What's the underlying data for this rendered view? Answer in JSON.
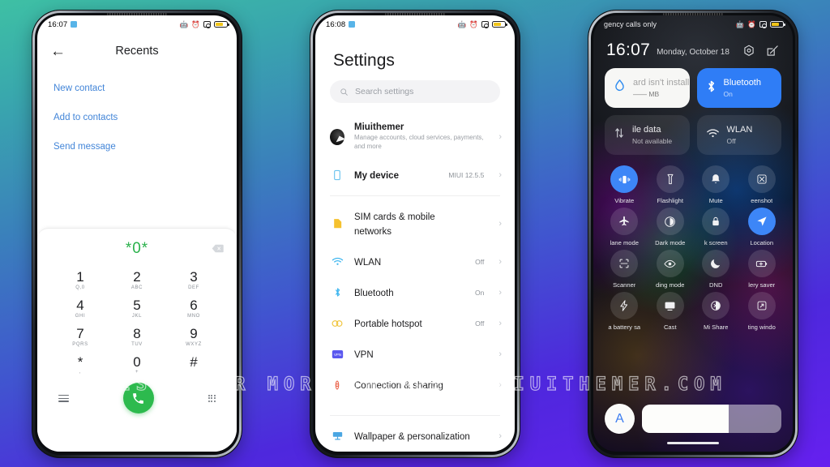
{
  "watermark": "VISIT FOR MORE THEMES - MIUITHEMER.COM",
  "phone1": {
    "status": {
      "time": "16:07",
      "icons": [
        "bluetooth-icon",
        "alarm-icon",
        "dnd-icon",
        "battery-icon"
      ]
    },
    "appbar": {
      "back": "←",
      "title": "Recents"
    },
    "links": [
      {
        "label": "New contact"
      },
      {
        "label": "Add to contacts"
      },
      {
        "label": "Send message"
      }
    ],
    "dialer": {
      "number": "*0*",
      "keys": [
        {
          "digit": "1",
          "sub": "Q,0"
        },
        {
          "digit": "2",
          "sub": "ABC"
        },
        {
          "digit": "3",
          "sub": "DEF"
        },
        {
          "digit": "4",
          "sub": "GHI"
        },
        {
          "digit": "5",
          "sub": "JKL"
        },
        {
          "digit": "6",
          "sub": "MNO"
        },
        {
          "digit": "7",
          "sub": "PQRS"
        },
        {
          "digit": "8",
          "sub": "TUV"
        },
        {
          "digit": "9",
          "sub": "WXYZ"
        },
        {
          "digit": "*",
          "sub": ","
        },
        {
          "digit": "0",
          "sub": "+"
        },
        {
          "digit": "#",
          "sub": ""
        }
      ],
      "call_icon": "✆"
    }
  },
  "phone2": {
    "status": {
      "time": "16:08"
    },
    "title": "Settings",
    "search": {
      "placeholder": "Search settings",
      "value": ""
    },
    "account": {
      "name": "Miuithemer",
      "subtitle": "Manage accounts, cloud services, payments, and more"
    },
    "rows": [
      {
        "label": "My device",
        "value": "MIUI 12.5.5",
        "icon": "device-icon"
      },
      {
        "label": "SIM cards & mobile networks",
        "value": "",
        "icon": "sim-icon"
      },
      {
        "label": "WLAN",
        "value": "Off",
        "icon": "wifi-icon"
      },
      {
        "label": "Bluetooth",
        "value": "On",
        "icon": "bluetooth-icon"
      },
      {
        "label": "Portable hotspot",
        "value": "Off",
        "icon": "hotspot-icon"
      },
      {
        "label": "VPN",
        "value": "",
        "icon": "vpn-icon"
      },
      {
        "label": "Connection & sharing",
        "value": "",
        "icon": "connection-icon"
      },
      {
        "label": "Wallpaper & personalization",
        "value": "",
        "icon": "wallpaper-icon"
      }
    ],
    "chevron": "›"
  },
  "phone3": {
    "status": {
      "carrier": "gency calls only"
    },
    "clock": {
      "time": "16:07",
      "date": "Monday, October 18"
    },
    "header_icons": [
      "settings-gear-icon",
      "edit-icon"
    ],
    "cards": [
      {
        "name": "ard isn't install",
        "state": "—— MB",
        "style": "light",
        "icon": "data-usage-icon"
      },
      {
        "name": "Bluetooth",
        "state": "On",
        "style": "blue",
        "icon": "bluetooth-icon"
      },
      {
        "name": "ile data",
        "state": "Not available",
        "style": "dim",
        "icon": "mobile-data-icon"
      },
      {
        "name": "WLAN",
        "state": "Off",
        "style": "dim",
        "icon": "wifi-icon"
      }
    ],
    "tiles": [
      {
        "label": "Vibrate",
        "icon": "vibrate-icon",
        "on": true
      },
      {
        "label": "Flashlight",
        "icon": "flashlight-icon",
        "on": false
      },
      {
        "label": "Mute",
        "icon": "bell-icon",
        "on": false
      },
      {
        "label": "eenshot",
        "icon": "screenshot-icon",
        "on": false
      },
      {
        "label": "lane mode",
        "icon": "airplane-icon",
        "on": false
      },
      {
        "label": "Dark mode",
        "icon": "dark-mode-icon",
        "on": false
      },
      {
        "label": "k screen",
        "icon": "lock-icon",
        "on": false
      },
      {
        "label": "Location",
        "icon": "location-icon",
        "on": true
      },
      {
        "label": "Scanner",
        "icon": "scanner-icon",
        "on": false
      },
      {
        "label": "ding mode",
        "icon": "eye-icon",
        "on": false
      },
      {
        "label": "DND",
        "icon": "moon-icon",
        "on": false
      },
      {
        "label": "lery saver",
        "icon": "battery-saver-icon",
        "on": false
      },
      {
        "label": "a battery sa",
        "icon": "bolt-icon",
        "on": false
      },
      {
        "label": "Cast",
        "icon": "cast-icon",
        "on": false
      },
      {
        "label": "Mi Share",
        "icon": "mi-share-icon",
        "on": false
      },
      {
        "label": "ting windo",
        "icon": "floating-window-icon",
        "on": false
      }
    ],
    "brightness": {
      "auto_label": "A",
      "percent": 62
    }
  },
  "colors": {
    "accent_green": "#2dba4e",
    "accent_blue": "#2f7df6",
    "link_blue": "#4285d8",
    "bg_top": "#3ec0a4",
    "bg_bottom": "#6620ef"
  }
}
